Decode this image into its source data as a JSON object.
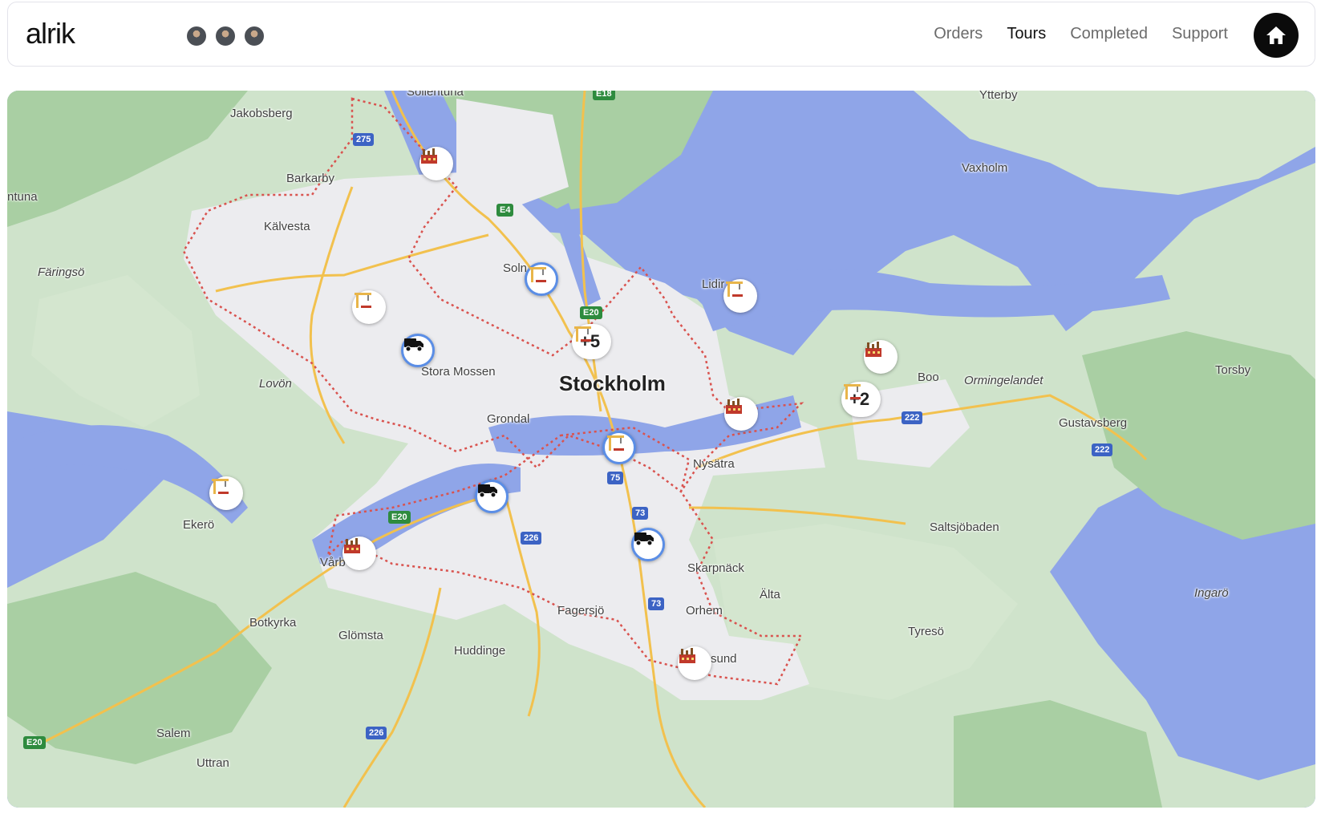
{
  "app": {
    "logo_text": "alrik"
  },
  "header": {
    "avatars": [
      "user-avatar-1",
      "user-avatar-2",
      "user-avatar-3"
    ],
    "nav": [
      {
        "label": "Orders",
        "active": false
      },
      {
        "label": "Tours",
        "active": true
      },
      {
        "label": "Completed",
        "active": false
      },
      {
        "label": "Support",
        "active": false
      }
    ],
    "home_icon": "home-icon"
  },
  "map": {
    "city_label": "Stockholm",
    "places": {
      "sollentuna": "Sollentuna",
      "jakobsberg": "Jakobsberg",
      "barkarby": "Barkarby",
      "kalvesta": "Kälvesta",
      "ntuna": "ntuna",
      "faringso": "Färingsö",
      "lovon": "Lovön",
      "stora_mossen": "Stora Mossen",
      "grondal": "Grondal",
      "solna": "Soln",
      "lidingo": "Lidir",
      "ytterby": "Ytterby",
      "vaxholm": "Vaxholm",
      "boo": "Boo",
      "ormingelandet": "Ormingelandet",
      "torsby": "Torsby",
      "gustavsberg": "Gustavsberg",
      "nysatra": "Nysätra",
      "saltsjobaden": "Saltsjöbaden",
      "skarpnack": "Skarpnäck",
      "alta": "Älta",
      "orhem": "Orhem",
      "fagersjo": "Fagersjö",
      "ingaro": "Ingarö",
      "tyreso": "Tyresö",
      "ekero": "Ekerö",
      "varby": "Vårb",
      "botkyrka": "Botkyrka",
      "glomsta": "Glömsta",
      "huddinge": "Huddinge",
      "sund": "sund",
      "salem": "Salem",
      "uttran": "Uttran"
    },
    "shields": {
      "e18": "E18",
      "r275": "275",
      "e4": "E4",
      "e20a": "E20",
      "r222a": "222",
      "r222b": "222",
      "r75": "75",
      "r73a": "73",
      "r73b": "73",
      "e20b": "E20",
      "r226a": "226",
      "r226b": "226",
      "e20c": "E20"
    },
    "clusters": [
      {
        "count": "+5"
      },
      {
        "count": "+2"
      }
    ],
    "colors": {
      "water": "#8fa5e8",
      "land": "#dbe9d7",
      "urban": "#efeff2",
      "road": "#f2c14e",
      "boundary": "#d9534f",
      "marker_ring": "#5b8ee6"
    }
  }
}
